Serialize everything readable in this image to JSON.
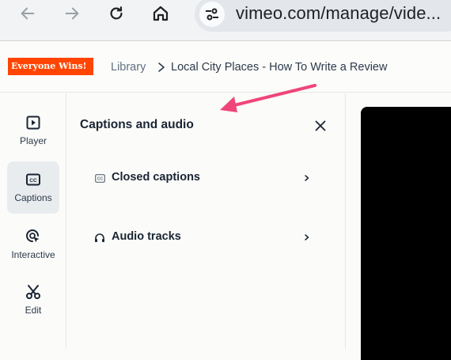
{
  "browser": {
    "url": "vimeo.com/manage/vide..."
  },
  "header": {
    "brand": "Everyone Wins!",
    "breadcrumb_library": "Library",
    "breadcrumb_current": "Local City Places - How To Write a Review"
  },
  "rail": {
    "items": [
      {
        "label": "Player",
        "icon": "play-square-icon"
      },
      {
        "label": "Captions",
        "icon": "cc-icon",
        "active": true
      },
      {
        "label": "Interactive",
        "icon": "interactive-cursor-icon"
      },
      {
        "label": "Edit",
        "icon": "scissors-icon"
      }
    ]
  },
  "panel": {
    "title": "Captions and audio",
    "rows": [
      {
        "label": "Closed captions",
        "icon": "cc-icon"
      },
      {
        "label": "Audio tracks",
        "icon": "headphones-icon"
      }
    ]
  },
  "colors": {
    "brand": "#ff4500",
    "annotation_arrow": "#f0457a",
    "video_bg": "#000000"
  }
}
